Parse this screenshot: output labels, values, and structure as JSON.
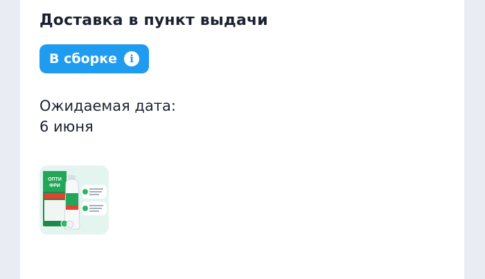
{
  "delivery": {
    "title": "Доставка в пункт выдачи",
    "status_badge": "В сборке",
    "expected_label": "Ожидаемая дата:",
    "expected_date": "6 июня"
  },
  "product": {
    "brand_line1": "ОПТИ",
    "brand_line2": "ФРИ"
  }
}
